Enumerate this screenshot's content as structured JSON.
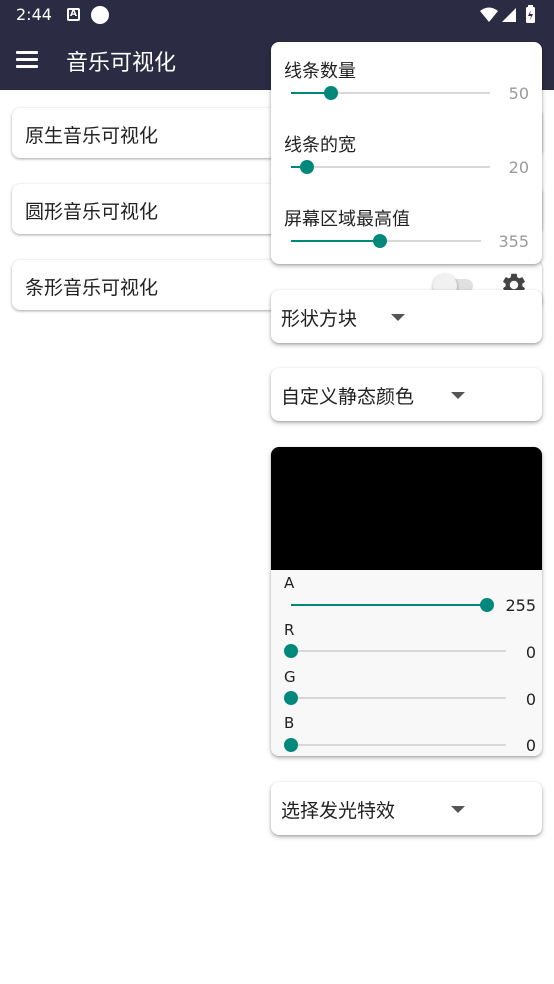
{
  "status_bar": {
    "time": "2:44",
    "notification_icon_letter": "A"
  },
  "app_bar": {
    "title": "音乐可视化",
    "menu_icon": "hamburger-menu-icon"
  },
  "list": [
    {
      "label": "原生音乐可视化"
    },
    {
      "label": "圆形音乐可视化"
    },
    {
      "label": "条形音乐可视化",
      "toggle_on": false,
      "settings_icon": "gear-icon"
    }
  ],
  "sliders_panel": {
    "items": [
      {
        "label": "线条数量",
        "value": "50",
        "fraction": 0.2
      },
      {
        "label": "线条的宽",
        "value": "20",
        "fraction": 0.08
      },
      {
        "label": "屏幕区域最高值",
        "value": "355",
        "fraction": 0.47
      }
    ]
  },
  "shape_dropdown": {
    "selected": "形状方块"
  },
  "color_mode_dropdown": {
    "selected": "自定义静态颜色"
  },
  "color_picker": {
    "preview_color": "#000000",
    "channels": [
      {
        "label": "A",
        "value": "255",
        "fraction": 1.0
      },
      {
        "label": "R",
        "value": "0",
        "fraction": 0.0
      },
      {
        "label": "G",
        "value": "0",
        "fraction": 0.0
      },
      {
        "label": "B",
        "value": "0",
        "fraction": 0.0
      }
    ]
  },
  "glow_dropdown": {
    "selected": "选择发光特效"
  },
  "colors": {
    "app_bar": "#2b2c44",
    "accent": "#00897b"
  }
}
